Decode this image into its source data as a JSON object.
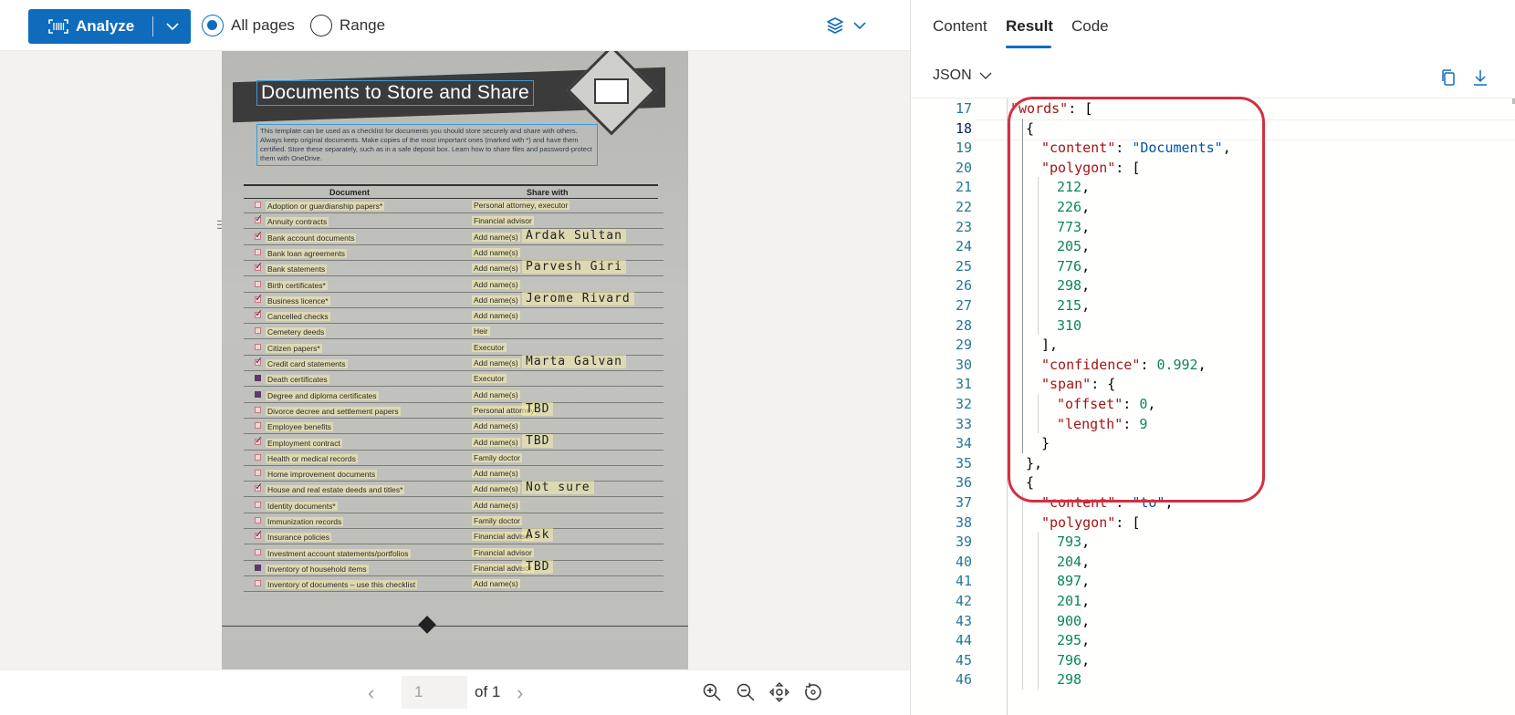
{
  "toolbar": {
    "analyze_label": "Analyze",
    "radio_all_pages": "All pages",
    "radio_range": "Range",
    "selected_mode": "All pages"
  },
  "document": {
    "title": "Documents to Store and Share",
    "intro": "This template can be used as a checklist for documents you should store securely and share with others. Always keep original documents. Make copies of the most important ones (marked with *) and have them certified. Store these separately, such as in a safe deposit box. Learn how to share files and password-protect them with OneDrive.",
    "col_document": "Document",
    "col_share": "Share with",
    "rows": [
      {
        "doc": "Adoption or guardianship papers*",
        "share": "Personal attorney, executor",
        "hand": "",
        "mark": "empty"
      },
      {
        "doc": "Annuity contracts",
        "share": "Financial advisor",
        "hand": "",
        "mark": "check"
      },
      {
        "doc": "Bank account documents",
        "share": "Add name(s)",
        "hand": "Ardak Sultan",
        "mark": "check"
      },
      {
        "doc": "Bank loan agreements",
        "share": "Add name(s)",
        "hand": "",
        "mark": "empty"
      },
      {
        "doc": "Bank statements",
        "share": "Add name(s)",
        "hand": "Parvesh Giri",
        "mark": "check"
      },
      {
        "doc": "Birth certificates*",
        "share": "Add name(s)",
        "hand": "",
        "mark": "empty"
      },
      {
        "doc": "Business licence*",
        "share": "Add name(s)",
        "hand": "Jerome Rivard",
        "mark": "check"
      },
      {
        "doc": "Cancelled checks",
        "share": "Add name(s)",
        "hand": "",
        "mark": "check"
      },
      {
        "doc": "Cemetery deeds",
        "share": "Heir",
        "hand": "",
        "mark": "empty"
      },
      {
        "doc": "Citizen papers*",
        "share": "Executor",
        "hand": "",
        "mark": "empty"
      },
      {
        "doc": "Credit card statements",
        "share": "Add name(s)",
        "hand": "Marta Galvan",
        "mark": "check"
      },
      {
        "doc": "Death certificates",
        "share": "Executor",
        "hand": "",
        "mark": "filled"
      },
      {
        "doc": "Degree and diploma certificates",
        "share": "Add name(s)",
        "hand": "",
        "mark": "filled"
      },
      {
        "doc": "Divorce decree and settlement papers",
        "share": "Personal attorney",
        "hand": "TBD",
        "mark": "empty"
      },
      {
        "doc": "Employee benefits",
        "share": "Add name(s)",
        "hand": "",
        "mark": "empty"
      },
      {
        "doc": "Employment contract",
        "share": "Add name(s)",
        "hand": "TBD",
        "mark": "check"
      },
      {
        "doc": "Health or medical records",
        "share": "Family doctor",
        "hand": "",
        "mark": "empty"
      },
      {
        "doc": "Home improvement documents",
        "share": "Add name(s)",
        "hand": "",
        "mark": "empty"
      },
      {
        "doc": "House and real estate deeds and titles*",
        "share": "Add name(s)",
        "hand": "Not sure",
        "mark": "check"
      },
      {
        "doc": "Identity documents*",
        "share": "Add name(s)",
        "hand": "",
        "mark": "empty"
      },
      {
        "doc": "Immunization records",
        "share": "Family doctor",
        "hand": "",
        "mark": "empty"
      },
      {
        "doc": "Insurance policies",
        "share": "Financial advisor",
        "hand": "Ask",
        "mark": "check"
      },
      {
        "doc": "Investment account statements/portfolios",
        "share": "Financial advisor",
        "hand": "",
        "mark": "empty"
      },
      {
        "doc": "Inventory of household items",
        "share": "Financial advisor",
        "hand": "TBD",
        "mark": "filled"
      },
      {
        "doc": "Inventory of documents – use this checklist",
        "share": "Add name(s)",
        "hand": "",
        "mark": "empty"
      }
    ]
  },
  "pager": {
    "current_page": "1",
    "of_label": "of 1"
  },
  "right_tabs": {
    "content": "Content",
    "result": "Result",
    "code": "Code",
    "active": "Result"
  },
  "format": {
    "selected": "JSON"
  },
  "code_lines": [
    {
      "n": "17",
      "indent": 0,
      "parts": [
        [
          "k",
          "\"words\""
        ],
        [
          "p",
          ": ["
        ]
      ]
    },
    {
      "n": "18",
      "indent": 1,
      "parts": [
        [
          "p",
          "{"
        ]
      ]
    },
    {
      "n": "19",
      "indent": 2,
      "parts": [
        [
          "k",
          "\"content\""
        ],
        [
          "p",
          ": "
        ],
        [
          "s",
          "\"Documents\""
        ],
        [
          "p",
          ","
        ]
      ]
    },
    {
      "n": "20",
      "indent": 2,
      "parts": [
        [
          "k",
          "\"polygon\""
        ],
        [
          "p",
          ": ["
        ]
      ]
    },
    {
      "n": "21",
      "indent": 3,
      "parts": [
        [
          "n",
          "212"
        ],
        [
          "p",
          ","
        ]
      ]
    },
    {
      "n": "22",
      "indent": 3,
      "parts": [
        [
          "n",
          "226"
        ],
        [
          "p",
          ","
        ]
      ]
    },
    {
      "n": "23",
      "indent": 3,
      "parts": [
        [
          "n",
          "773"
        ],
        [
          "p",
          ","
        ]
      ]
    },
    {
      "n": "24",
      "indent": 3,
      "parts": [
        [
          "n",
          "205"
        ],
        [
          "p",
          ","
        ]
      ]
    },
    {
      "n": "25",
      "indent": 3,
      "parts": [
        [
          "n",
          "776"
        ],
        [
          "p",
          ","
        ]
      ]
    },
    {
      "n": "26",
      "indent": 3,
      "parts": [
        [
          "n",
          "298"
        ],
        [
          "p",
          ","
        ]
      ]
    },
    {
      "n": "27",
      "indent": 3,
      "parts": [
        [
          "n",
          "215"
        ],
        [
          "p",
          ","
        ]
      ]
    },
    {
      "n": "28",
      "indent": 3,
      "parts": [
        [
          "n",
          "310"
        ]
      ]
    },
    {
      "n": "29",
      "indent": 2,
      "parts": [
        [
          "p",
          "],"
        ]
      ]
    },
    {
      "n": "30",
      "indent": 2,
      "parts": [
        [
          "k",
          "\"confidence\""
        ],
        [
          "p",
          ": "
        ],
        [
          "n",
          "0.992"
        ],
        [
          "p",
          ","
        ]
      ]
    },
    {
      "n": "31",
      "indent": 2,
      "parts": [
        [
          "k",
          "\"span\""
        ],
        [
          "p",
          ": {"
        ]
      ]
    },
    {
      "n": "32",
      "indent": 3,
      "parts": [
        [
          "k",
          "\"offset\""
        ],
        [
          "p",
          ": "
        ],
        [
          "n",
          "0"
        ],
        [
          "p",
          ","
        ]
      ]
    },
    {
      "n": "33",
      "indent": 3,
      "parts": [
        [
          "k",
          "\"length\""
        ],
        [
          "p",
          ": "
        ],
        [
          "n",
          "9"
        ]
      ]
    },
    {
      "n": "34",
      "indent": 2,
      "parts": [
        [
          "p",
          "}"
        ]
      ]
    },
    {
      "n": "35",
      "indent": 1,
      "parts": [
        [
          "p",
          "},"
        ]
      ]
    },
    {
      "n": "36",
      "indent": 1,
      "parts": [
        [
          "p",
          "{"
        ]
      ]
    },
    {
      "n": "37",
      "indent": 2,
      "parts": [
        [
          "k",
          "\"content\""
        ],
        [
          "p",
          ": "
        ],
        [
          "s",
          "\"to\""
        ],
        [
          "p",
          ","
        ]
      ]
    },
    {
      "n": "38",
      "indent": 2,
      "parts": [
        [
          "k",
          "\"polygon\""
        ],
        [
          "p",
          ": ["
        ]
      ]
    },
    {
      "n": "39",
      "indent": 3,
      "parts": [
        [
          "n",
          "793"
        ],
        [
          "p",
          ","
        ]
      ]
    },
    {
      "n": "40",
      "indent": 3,
      "parts": [
        [
          "n",
          "204"
        ],
        [
          "p",
          ","
        ]
      ]
    },
    {
      "n": "41",
      "indent": 3,
      "parts": [
        [
          "n",
          "897"
        ],
        [
          "p",
          ","
        ]
      ]
    },
    {
      "n": "42",
      "indent": 3,
      "parts": [
        [
          "n",
          "201"
        ],
        [
          "p",
          ","
        ]
      ]
    },
    {
      "n": "43",
      "indent": 3,
      "parts": [
        [
          "n",
          "900"
        ],
        [
          "p",
          ","
        ]
      ]
    },
    {
      "n": "44",
      "indent": 3,
      "parts": [
        [
          "n",
          "295"
        ],
        [
          "p",
          ","
        ]
      ]
    },
    {
      "n": "45",
      "indent": 3,
      "parts": [
        [
          "n",
          "796"
        ],
        [
          "p",
          ","
        ]
      ]
    },
    {
      "n": "46",
      "indent": 3,
      "parts": [
        [
          "n",
          "298"
        ]
      ]
    }
  ],
  "current_line": "18",
  "colors": {
    "accent": "#0f6cbd",
    "highlight_border": "#d32f3f",
    "json_key": "#a31515",
    "json_string": "#0451a5",
    "json_number": "#098658"
  },
  "icons": {
    "analyze": "scan-icon",
    "dropdown": "chevron-down-icon",
    "layers": "layers-icon",
    "copy": "copy-icon",
    "download": "download-icon",
    "zoom_in": "zoom-in-icon",
    "zoom_out": "zoom-out-icon",
    "fit": "fit-page-icon",
    "rotate": "rotate-icon"
  }
}
